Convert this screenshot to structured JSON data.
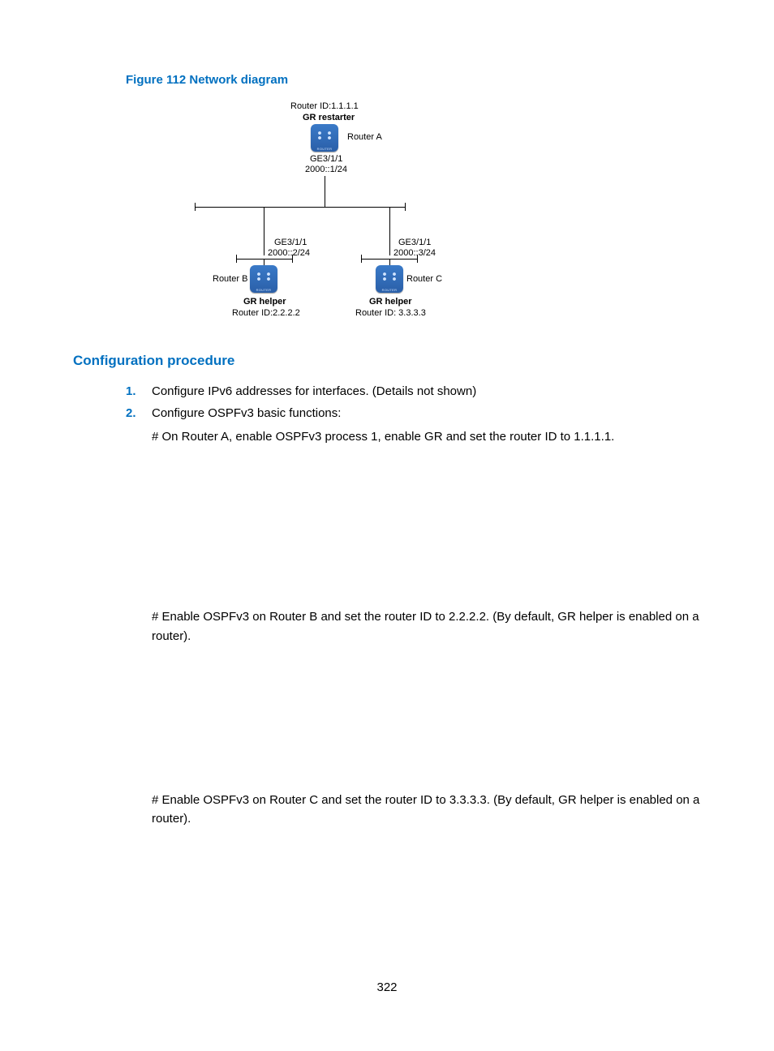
{
  "figure": {
    "title": "Figure 112 Network diagram",
    "routerA": {
      "id": "Router ID:1.1.1.1",
      "role": "GR restarter",
      "name": "Router A",
      "iface": "GE3/1/1",
      "addr": "2000::1/24"
    },
    "routerB": {
      "iface": "GE3/1/1",
      "addr": "2000::2/24",
      "name": "Router B",
      "role": "GR helper",
      "id": "Router ID:2.2.2.2"
    },
    "routerC": {
      "iface": "GE3/1/1",
      "addr": "2000::3/24",
      "name": "Router C",
      "role": "GR helper",
      "id": "Router ID: 3.3.3.3"
    }
  },
  "section": {
    "title": "Configuration procedure",
    "items": [
      {
        "num": "1.",
        "text": "Configure IPv6 addresses for interfaces. (Details not shown)"
      },
      {
        "num": "2.",
        "text": "Configure OSPFv3 basic functions:"
      }
    ],
    "desc_a": "# On Router A, enable OSPFv3 process 1, enable GR and set the router ID to 1.1.1.1.",
    "desc_b": "# Enable OSPFv3 on Router B and set the router ID to 2.2.2.2. (By default, GR helper is enabled on a router).",
    "desc_c": "# Enable OSPFv3 on Router C and set the router ID to 3.3.3.3. (By default, GR helper is enabled on a router)."
  },
  "page_number": "322"
}
